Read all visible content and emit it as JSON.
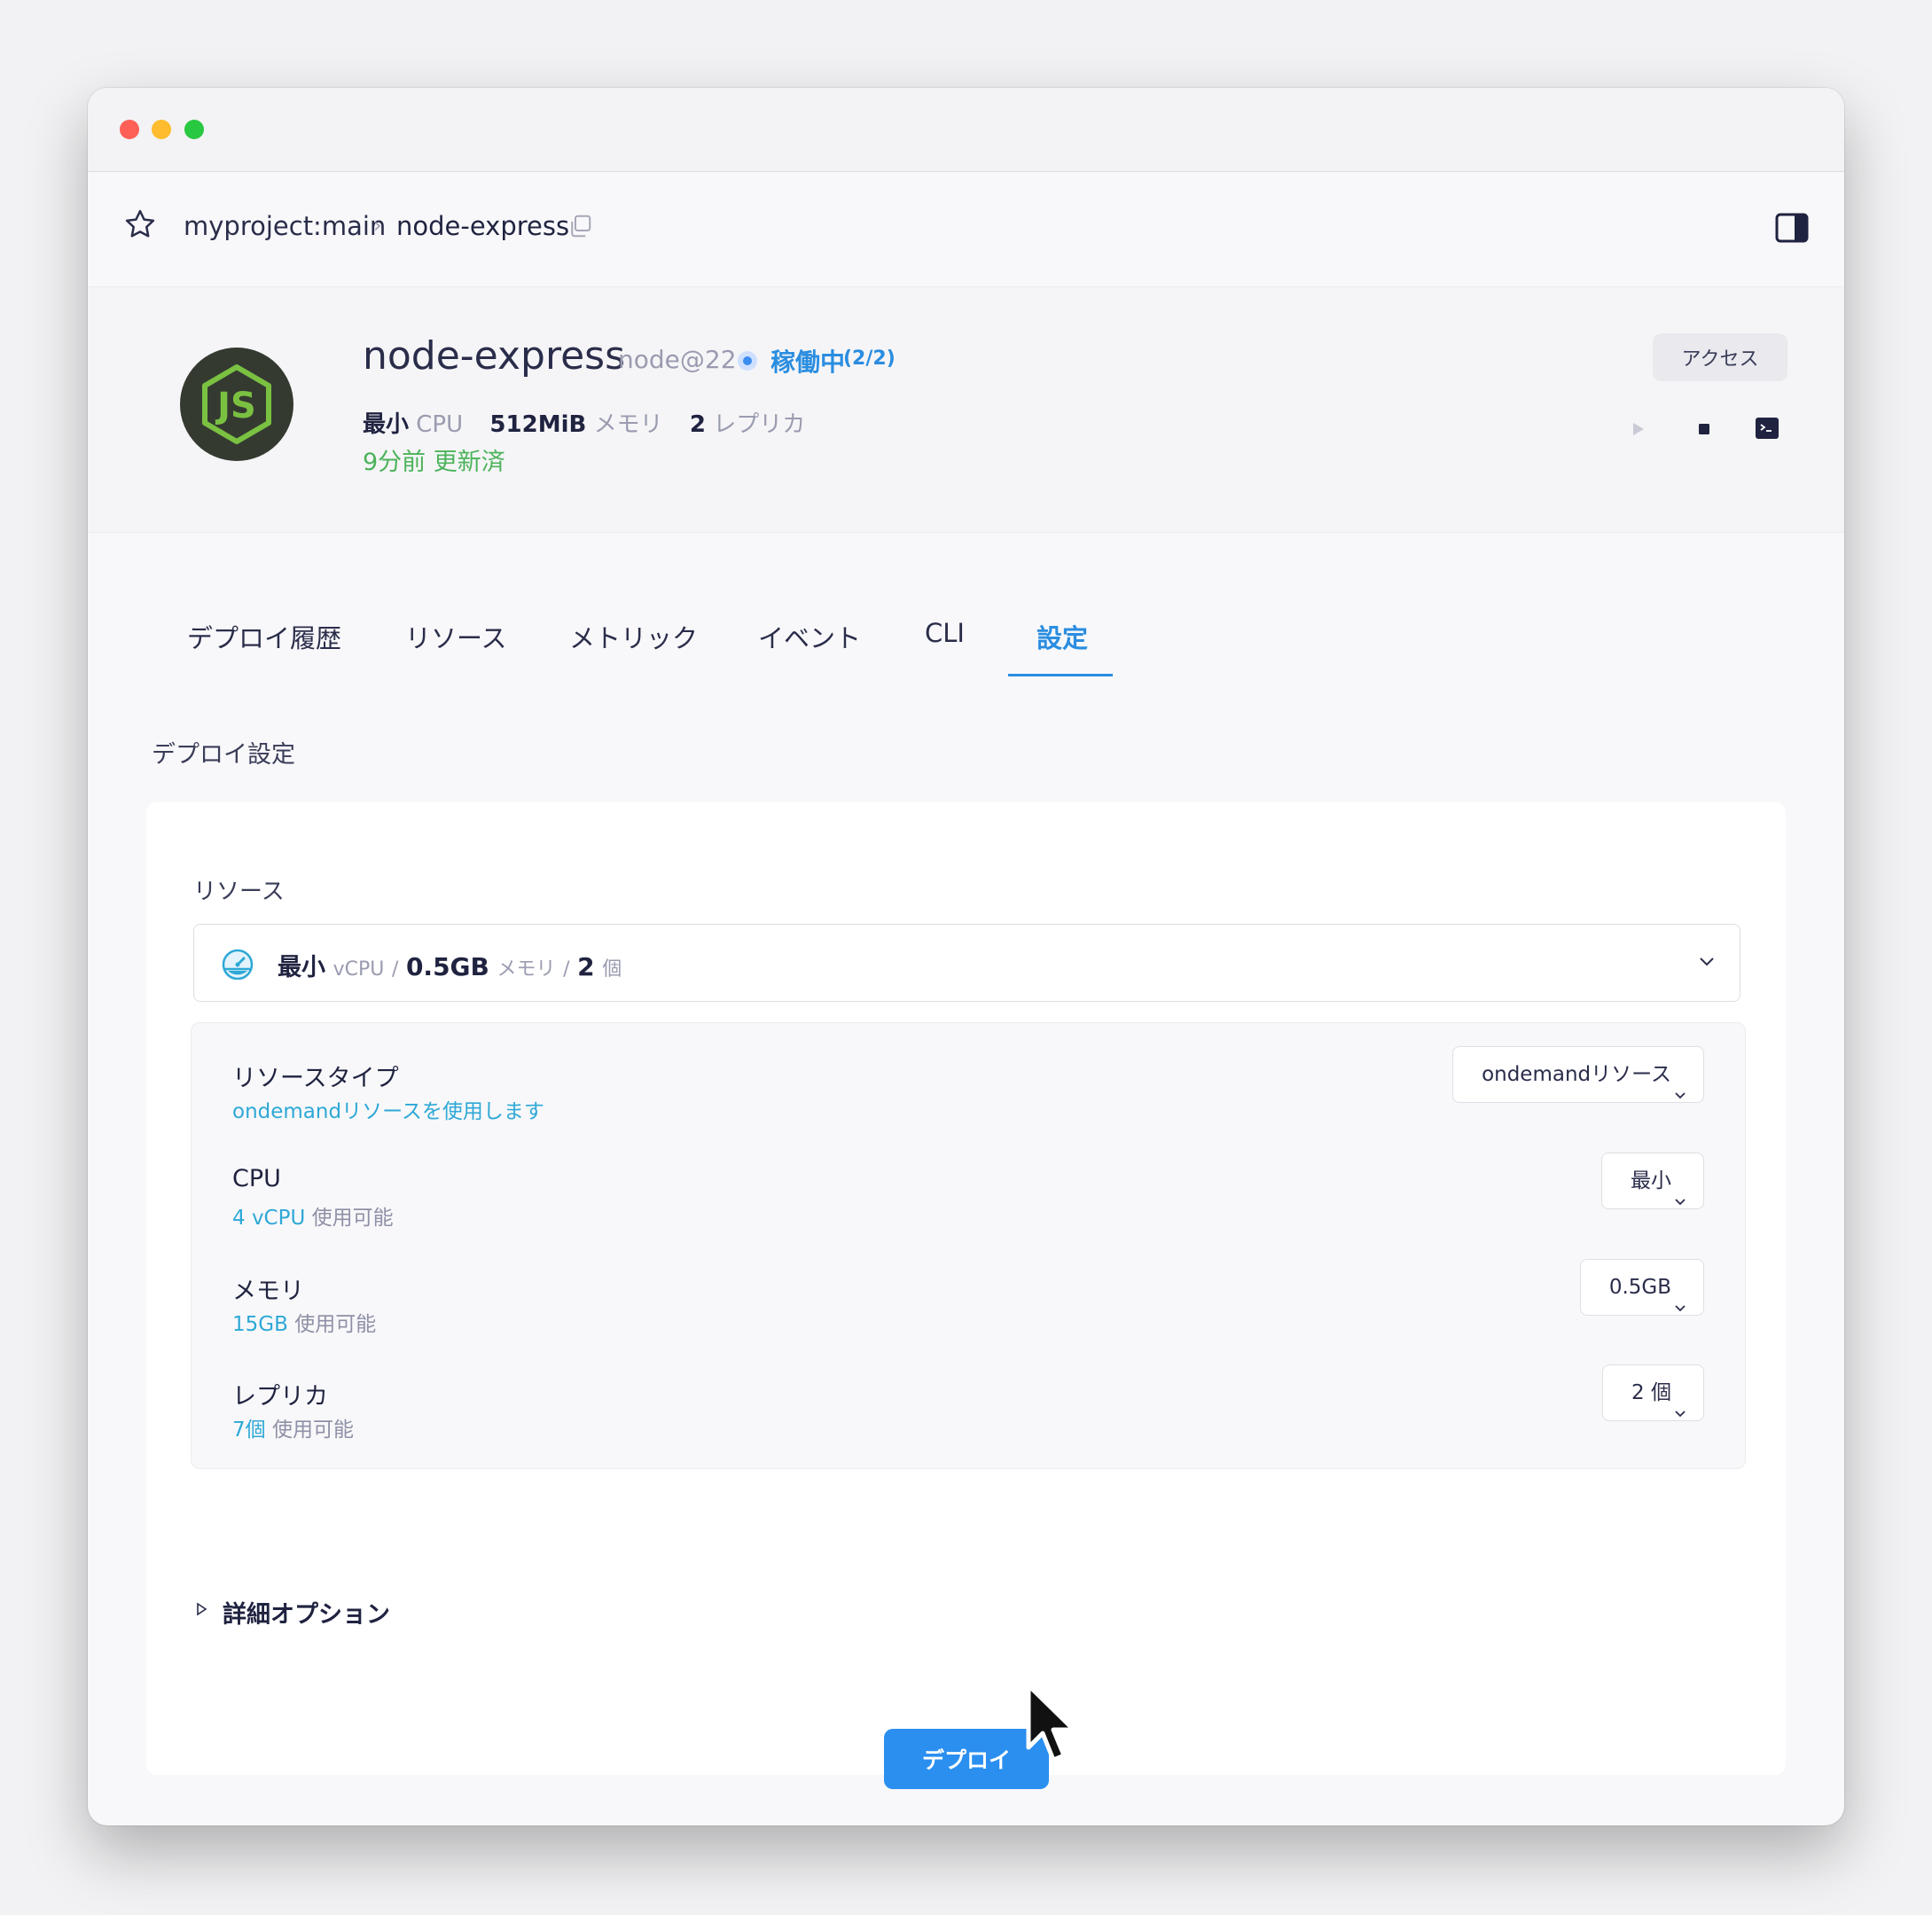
{
  "breadcrumb": {
    "project": "myproject:main",
    "separator": "›",
    "current": "node-express"
  },
  "header": {
    "app_name": "node-express",
    "runtime": "node@22",
    "status_label": "稼働中",
    "status_count": "(2/2)",
    "specs": {
      "cpu_value": "最小",
      "cpu_unit": "CPU",
      "memory_value": "512MiB",
      "memory_unit": "メモリ",
      "replica_value": "2",
      "replica_unit": "レプリカ"
    },
    "updated": "9分前 更新済",
    "access_label": "アクセス",
    "logo_text": "JS"
  },
  "tabs": [
    "デプロイ履歴",
    "リソース",
    "メトリック",
    "イベント",
    "CLI",
    "設定"
  ],
  "active_tab": "設定",
  "settings": {
    "section_title": "デプロイ設定",
    "resource_label": "リソース",
    "summary": {
      "cpu_value": "最小",
      "cpu_unit": "vCPU",
      "sep": "/",
      "memory_value": "0.5GB",
      "memory_unit": "メモリ",
      "replica_value": "2",
      "replica_unit": "個"
    },
    "rows": [
      {
        "title": "リソースタイプ",
        "highlight": "ondemandリソースを使用します",
        "muted": "",
        "value": "ondemandリソース"
      },
      {
        "title": "CPU",
        "highlight": "4 vCPU",
        "muted": "使用可能",
        "value": "最小"
      },
      {
        "title": "メモリ",
        "highlight": "15GB",
        "muted": "使用可能",
        "value": "0.5GB"
      },
      {
        "title": "レプリカ",
        "highlight": "7個",
        "muted": "使用可能",
        "value": "2 個"
      }
    ],
    "advanced_label": "詳細オプション",
    "deploy_label": "デプロイ"
  },
  "colors": {
    "accent": "#2b8ff0",
    "status_blue": "#2a8de0",
    "updated_green": "#4cb35a",
    "highlight_teal": "#2ea8d6"
  }
}
